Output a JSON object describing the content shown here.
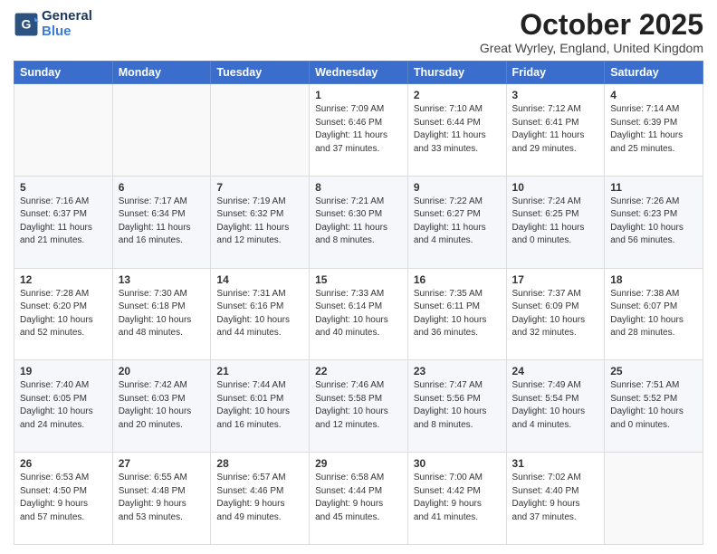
{
  "header": {
    "logo_line1": "General",
    "logo_line2": "Blue",
    "month_title": "October 2025",
    "location": "Great Wyrley, England, United Kingdom"
  },
  "weekdays": [
    "Sunday",
    "Monday",
    "Tuesday",
    "Wednesday",
    "Thursday",
    "Friday",
    "Saturday"
  ],
  "weeks": [
    [
      {
        "day": "",
        "info": ""
      },
      {
        "day": "",
        "info": ""
      },
      {
        "day": "",
        "info": ""
      },
      {
        "day": "1",
        "info": "Sunrise: 7:09 AM\nSunset: 6:46 PM\nDaylight: 11 hours\nand 37 minutes."
      },
      {
        "day": "2",
        "info": "Sunrise: 7:10 AM\nSunset: 6:44 PM\nDaylight: 11 hours\nand 33 minutes."
      },
      {
        "day": "3",
        "info": "Sunrise: 7:12 AM\nSunset: 6:41 PM\nDaylight: 11 hours\nand 29 minutes."
      },
      {
        "day": "4",
        "info": "Sunrise: 7:14 AM\nSunset: 6:39 PM\nDaylight: 11 hours\nand 25 minutes."
      }
    ],
    [
      {
        "day": "5",
        "info": "Sunrise: 7:16 AM\nSunset: 6:37 PM\nDaylight: 11 hours\nand 21 minutes."
      },
      {
        "day": "6",
        "info": "Sunrise: 7:17 AM\nSunset: 6:34 PM\nDaylight: 11 hours\nand 16 minutes."
      },
      {
        "day": "7",
        "info": "Sunrise: 7:19 AM\nSunset: 6:32 PM\nDaylight: 11 hours\nand 12 minutes."
      },
      {
        "day": "8",
        "info": "Sunrise: 7:21 AM\nSunset: 6:30 PM\nDaylight: 11 hours\nand 8 minutes."
      },
      {
        "day": "9",
        "info": "Sunrise: 7:22 AM\nSunset: 6:27 PM\nDaylight: 11 hours\nand 4 minutes."
      },
      {
        "day": "10",
        "info": "Sunrise: 7:24 AM\nSunset: 6:25 PM\nDaylight: 11 hours\nand 0 minutes."
      },
      {
        "day": "11",
        "info": "Sunrise: 7:26 AM\nSunset: 6:23 PM\nDaylight: 10 hours\nand 56 minutes."
      }
    ],
    [
      {
        "day": "12",
        "info": "Sunrise: 7:28 AM\nSunset: 6:20 PM\nDaylight: 10 hours\nand 52 minutes."
      },
      {
        "day": "13",
        "info": "Sunrise: 7:30 AM\nSunset: 6:18 PM\nDaylight: 10 hours\nand 48 minutes."
      },
      {
        "day": "14",
        "info": "Sunrise: 7:31 AM\nSunset: 6:16 PM\nDaylight: 10 hours\nand 44 minutes."
      },
      {
        "day": "15",
        "info": "Sunrise: 7:33 AM\nSunset: 6:14 PM\nDaylight: 10 hours\nand 40 minutes."
      },
      {
        "day": "16",
        "info": "Sunrise: 7:35 AM\nSunset: 6:11 PM\nDaylight: 10 hours\nand 36 minutes."
      },
      {
        "day": "17",
        "info": "Sunrise: 7:37 AM\nSunset: 6:09 PM\nDaylight: 10 hours\nand 32 minutes."
      },
      {
        "day": "18",
        "info": "Sunrise: 7:38 AM\nSunset: 6:07 PM\nDaylight: 10 hours\nand 28 minutes."
      }
    ],
    [
      {
        "day": "19",
        "info": "Sunrise: 7:40 AM\nSunset: 6:05 PM\nDaylight: 10 hours\nand 24 minutes."
      },
      {
        "day": "20",
        "info": "Sunrise: 7:42 AM\nSunset: 6:03 PM\nDaylight: 10 hours\nand 20 minutes."
      },
      {
        "day": "21",
        "info": "Sunrise: 7:44 AM\nSunset: 6:01 PM\nDaylight: 10 hours\nand 16 minutes."
      },
      {
        "day": "22",
        "info": "Sunrise: 7:46 AM\nSunset: 5:58 PM\nDaylight: 10 hours\nand 12 minutes."
      },
      {
        "day": "23",
        "info": "Sunrise: 7:47 AM\nSunset: 5:56 PM\nDaylight: 10 hours\nand 8 minutes."
      },
      {
        "day": "24",
        "info": "Sunrise: 7:49 AM\nSunset: 5:54 PM\nDaylight: 10 hours\nand 4 minutes."
      },
      {
        "day": "25",
        "info": "Sunrise: 7:51 AM\nSunset: 5:52 PM\nDaylight: 10 hours\nand 0 minutes."
      }
    ],
    [
      {
        "day": "26",
        "info": "Sunrise: 6:53 AM\nSunset: 4:50 PM\nDaylight: 9 hours\nand 57 minutes."
      },
      {
        "day": "27",
        "info": "Sunrise: 6:55 AM\nSunset: 4:48 PM\nDaylight: 9 hours\nand 53 minutes."
      },
      {
        "day": "28",
        "info": "Sunrise: 6:57 AM\nSunset: 4:46 PM\nDaylight: 9 hours\nand 49 minutes."
      },
      {
        "day": "29",
        "info": "Sunrise: 6:58 AM\nSunset: 4:44 PM\nDaylight: 9 hours\nand 45 minutes."
      },
      {
        "day": "30",
        "info": "Sunrise: 7:00 AM\nSunset: 4:42 PM\nDaylight: 9 hours\nand 41 minutes."
      },
      {
        "day": "31",
        "info": "Sunrise: 7:02 AM\nSunset: 4:40 PM\nDaylight: 9 hours\nand 37 minutes."
      },
      {
        "day": "",
        "info": ""
      }
    ]
  ]
}
